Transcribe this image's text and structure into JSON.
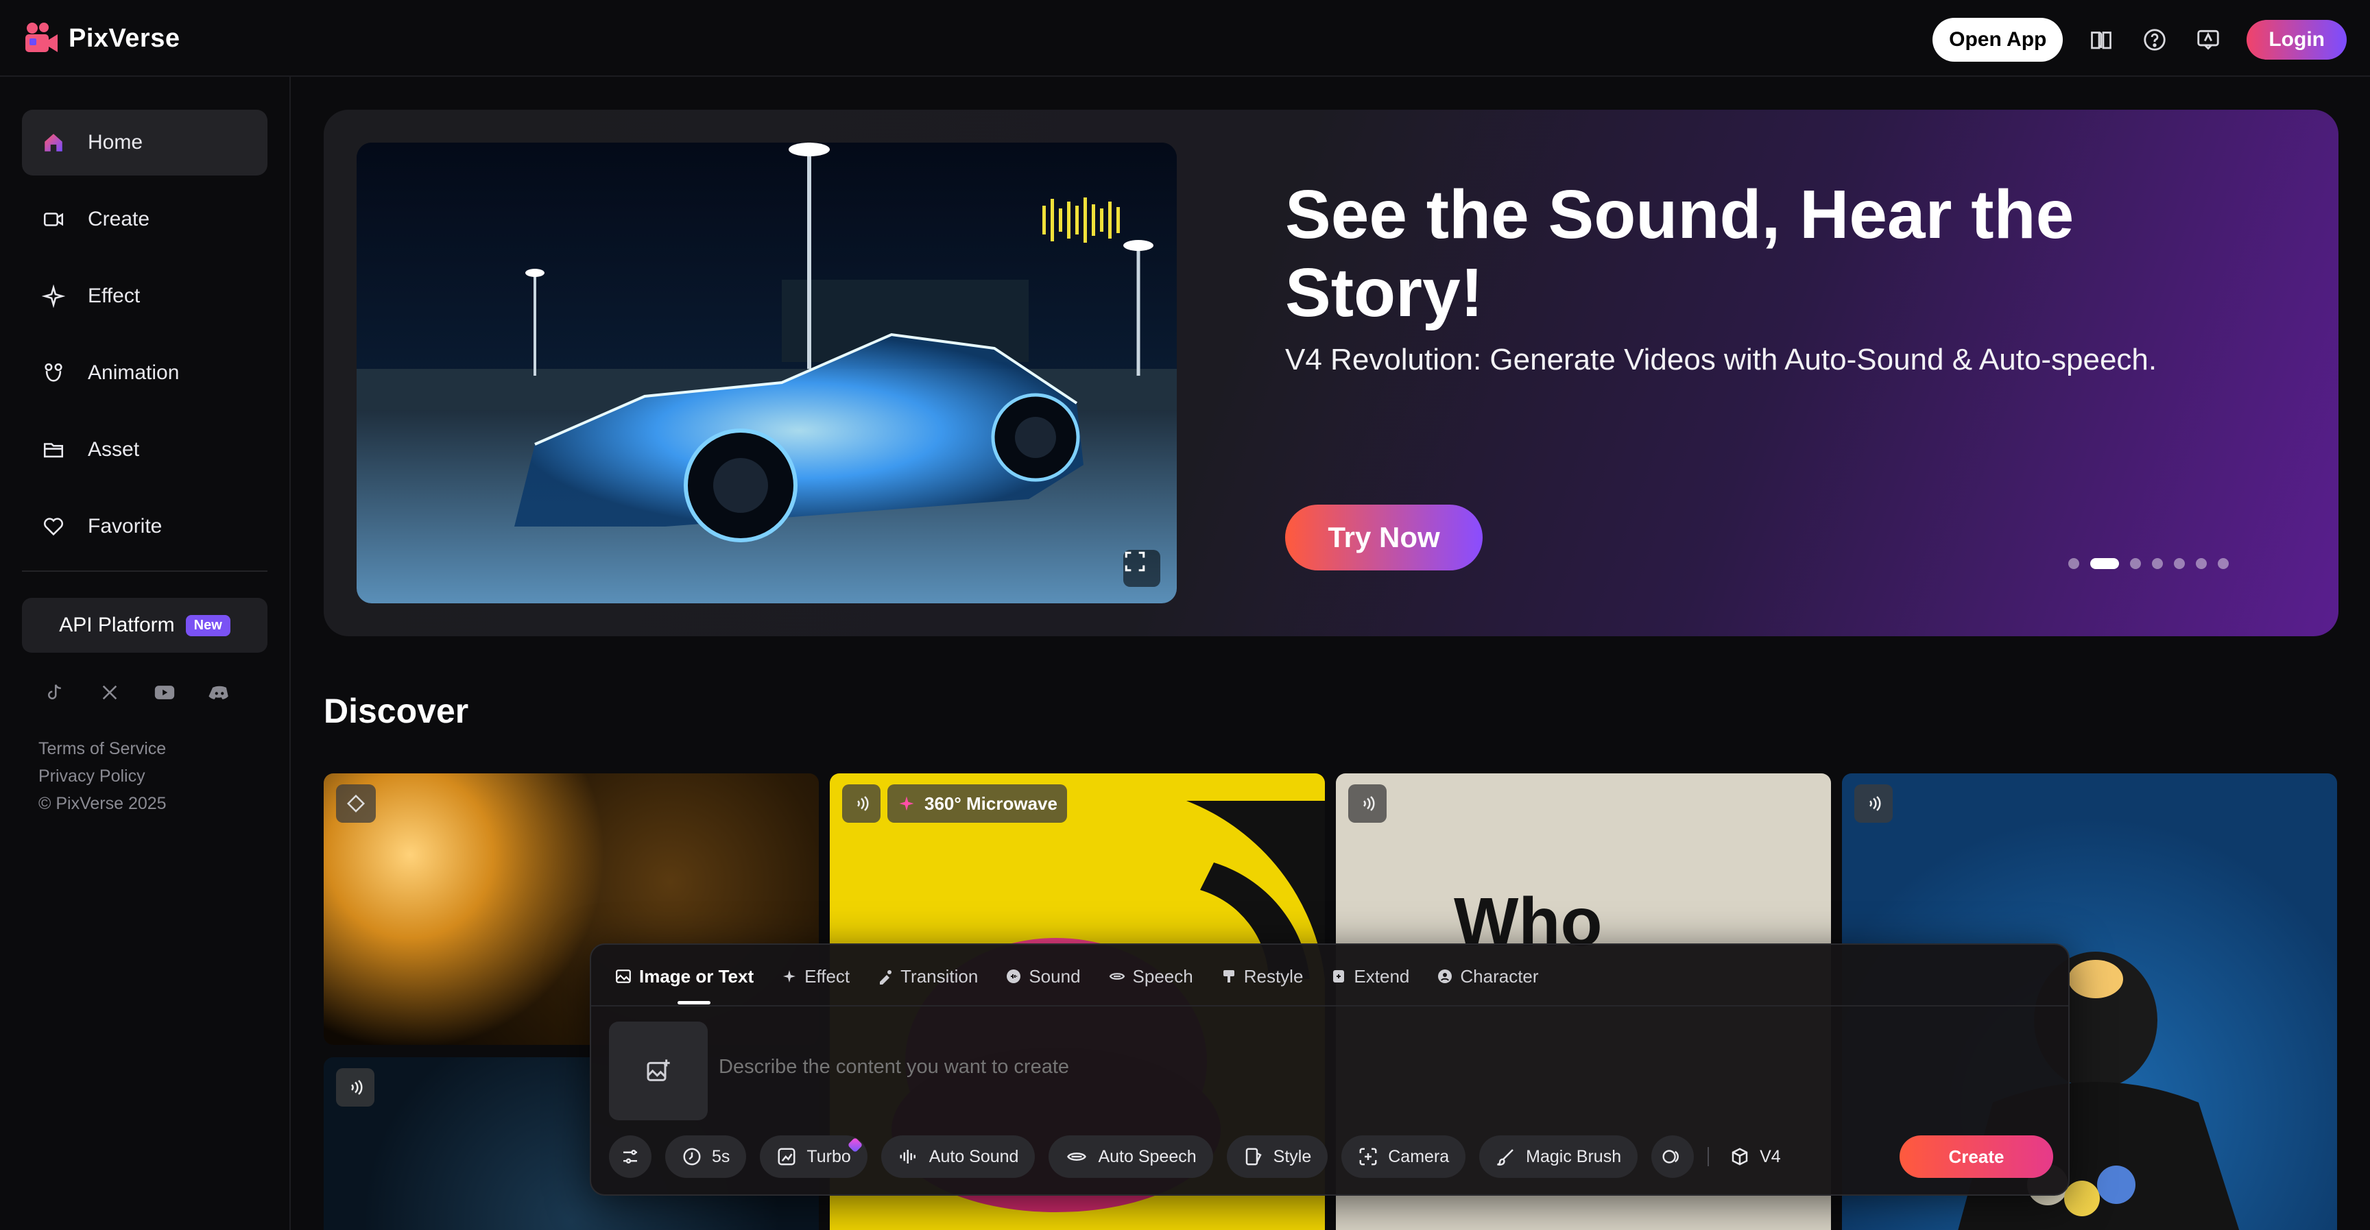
{
  "app": {
    "name": "PixVerse"
  },
  "topbar": {
    "open_app_label": "Open App",
    "login_label": "Login",
    "icons": [
      "book-icon",
      "help-icon",
      "feedback-icon"
    ]
  },
  "sidebar": {
    "items": [
      {
        "label": "Home",
        "icon": "home-icon",
        "active": true
      },
      {
        "label": "Create",
        "icon": "video-camera-icon"
      },
      {
        "label": "Effect",
        "icon": "sparkle-icon"
      },
      {
        "label": "Animation",
        "icon": "animation-icon"
      },
      {
        "label": "Asset",
        "icon": "folder-icon"
      },
      {
        "label": "Favorite",
        "icon": "heart-icon"
      }
    ],
    "api_platform_label": "API Platform",
    "api_badge": "New",
    "socials": [
      "tiktok-icon",
      "x-icon",
      "youtube-icon",
      "discord-icon"
    ],
    "footer": {
      "terms": "Terms of Service",
      "privacy": "Privacy Policy",
      "copyright": "© PixVerse 2025"
    }
  },
  "hero": {
    "title": "See the Sound, Hear the Story!",
    "subtitle": "V4 Revolution: Generate Videos with Auto-Sound & Auto-speech.",
    "cta_label": "Try Now",
    "slide_count": 7,
    "active_slide": 2
  },
  "discover": {
    "title": "Discover",
    "cards": [
      {
        "badge_icon": "diamond-icon"
      },
      {
        "badge_icon": "sound-icon",
        "badge_label": "360° Microwave"
      },
      {
        "badge_icon": "sound-icon",
        "overlay_text": "Who"
      },
      {
        "badge_icon": "sound-icon"
      },
      {
        "badge_icon": "sound-icon"
      }
    ]
  },
  "composer": {
    "tabs": [
      {
        "label": "Image or Text",
        "icon": "image-icon",
        "active": true
      },
      {
        "label": "Effect",
        "icon": "sparkle-icon"
      },
      {
        "label": "Transition",
        "icon": "transition-icon"
      },
      {
        "label": "Sound",
        "icon": "sound-icon"
      },
      {
        "label": "Speech",
        "icon": "speech-icon"
      },
      {
        "label": "Restyle",
        "icon": "brush-icon"
      },
      {
        "label": "Extend",
        "icon": "extend-icon"
      },
      {
        "label": "Character",
        "icon": "character-icon"
      }
    ],
    "prompt_placeholder": "Describe the content you want to create",
    "toolbar": {
      "duration": "5s",
      "turbo": "Turbo",
      "auto_sound": "Auto Sound",
      "auto_speech": "Auto Speech",
      "style": "Style",
      "camera": "Camera",
      "magic_brush": "Magic Brush",
      "model": "V4"
    },
    "create_label": "Create"
  },
  "colors": {
    "accent_gradient_start": "#ff5a3d",
    "accent_gradient_end": "#8a4dff",
    "background": "#0b0b0d",
    "badge_new": "#7a52f4"
  }
}
